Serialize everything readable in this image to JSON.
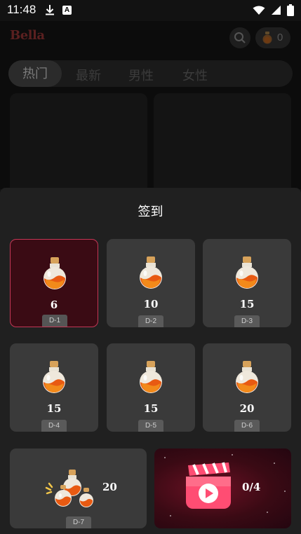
{
  "status_bar": {
    "time": "11:48"
  },
  "app": {
    "logo_text": "Bella",
    "coin_count": "0",
    "tabs": [
      {
        "label": "热门"
      },
      {
        "label": "最新"
      },
      {
        "label": "男性"
      },
      {
        "label": "女性"
      }
    ]
  },
  "checkin": {
    "title": "签到",
    "days": [
      {
        "amount": "6",
        "label": "D-1"
      },
      {
        "amount": "10",
        "label": "D-2"
      },
      {
        "amount": "15",
        "label": "D-3"
      },
      {
        "amount": "15",
        "label": "D-4"
      },
      {
        "amount": "15",
        "label": "D-5"
      },
      {
        "amount": "20",
        "label": "D-6"
      }
    ],
    "day7": {
      "amount": "20",
      "label": "D-7"
    },
    "video": {
      "progress": "0/4"
    }
  },
  "colors": {
    "current_border": "#c43756",
    "current_bg": "#3a0b14",
    "card_bg": "#3a3a3a",
    "sheet_bg": "#202020"
  }
}
